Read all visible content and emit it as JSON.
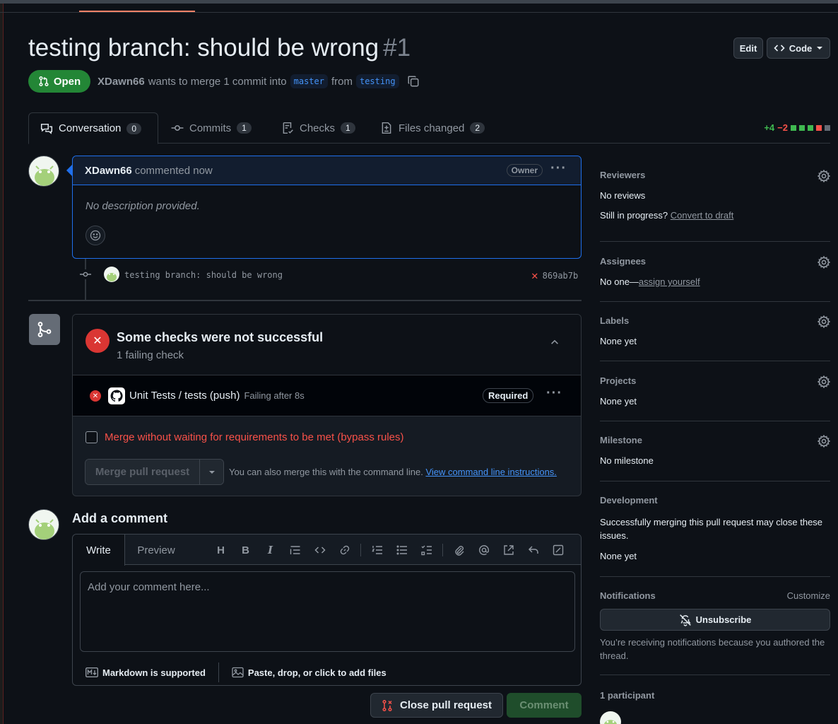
{
  "pr": {
    "title": "testing branch: should be wrong",
    "number": "#1",
    "state": "Open",
    "author": "XDawn66",
    "merge_text": "wants to merge 1 commit into",
    "base_branch": "master",
    "from_text": "from",
    "head_branch": "testing"
  },
  "header_buttons": {
    "edit": "Edit",
    "code": "Code"
  },
  "tabs": [
    {
      "label": "Conversation",
      "count": "0"
    },
    {
      "label": "Commits",
      "count": "1"
    },
    {
      "label": "Checks",
      "count": "1"
    },
    {
      "label": "Files changed",
      "count": "2"
    }
  ],
  "diffstat": {
    "additions": "+4",
    "deletions": "−2"
  },
  "comment": {
    "author": "XDawn66",
    "action": "commented now",
    "badge": "Owner",
    "body": "No description provided."
  },
  "commit": {
    "message": "testing branch: should be wrong",
    "sha": "869ab7b"
  },
  "checks": {
    "title": "Some checks were not successful",
    "subtitle": "1 failing check",
    "item_name": "Unit Tests / tests (push)",
    "item_status": "Failing after 8s",
    "required": "Required"
  },
  "merge": {
    "bypass_label": "Merge without waiting for requirements to be met (bypass rules)",
    "button": "Merge pull request",
    "hint": "You can also merge this with the command line.",
    "hint_link": "View command line instructions."
  },
  "add_comment": {
    "title": "Add a comment",
    "tab_write": "Write",
    "tab_preview": "Preview",
    "placeholder": "Add your comment here...",
    "markdown": "Markdown is supported",
    "attach": "Paste, drop, or click to add files",
    "close_pr": "Close pull request",
    "comment_btn": "Comment"
  },
  "sidebar": {
    "reviewers": {
      "title": "Reviewers",
      "value": "No reviews",
      "progress": "Still in progress?",
      "convert": "Convert to draft"
    },
    "assignees": {
      "title": "Assignees",
      "value": "No one—",
      "assign": "assign yourself"
    },
    "labels": {
      "title": "Labels",
      "value": "None yet"
    },
    "projects": {
      "title": "Projects",
      "value": "None yet"
    },
    "milestone": {
      "title": "Milestone",
      "value": "No milestone"
    },
    "development": {
      "title": "Development",
      "text": "Successfully merging this pull request may close these issues.",
      "value": "None yet"
    },
    "notifications": {
      "title": "Notifications",
      "customize": "Customize",
      "unsubscribe": "Unsubscribe",
      "reason": "You’re receiving notifications because you authored the thread."
    },
    "participants": {
      "title": "1 participant"
    }
  },
  "colors": {
    "open_green": "#238636",
    "fail_red": "#da3633",
    "link_blue": "#4493f8",
    "focus_blue": "#1f6feb"
  }
}
